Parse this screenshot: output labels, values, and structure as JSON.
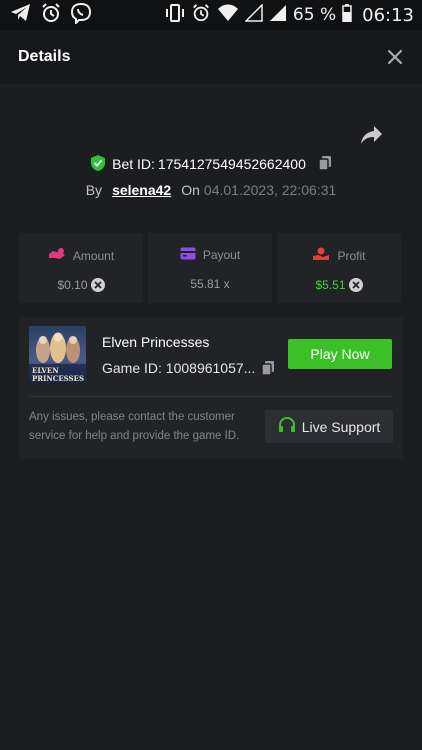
{
  "statusbar": {
    "battery": "65 %",
    "time": "06:13"
  },
  "header": {
    "title": "Details"
  },
  "bet": {
    "id_label": "Bet ID:",
    "id_value": "1754127549452662400",
    "by_label": "By",
    "username": "selena42",
    "on_label": "On",
    "date": "04.01.2023, 22:06:31"
  },
  "stats": {
    "amount": {
      "label": "Amount",
      "value": "$0.10"
    },
    "payout": {
      "label": "Payout",
      "value": "55.81 x"
    },
    "profit": {
      "label": "Profit",
      "value": "$5.51"
    }
  },
  "game": {
    "name": "Elven Princesses",
    "id_label": "Game ID:",
    "id_value": "1008961057...",
    "thumb_line1": "ELVEN",
    "thumb_line2": "PRINCESSES",
    "play_label": "Play Now",
    "issue_text": "Any issues, please contact the customer service for help and provide the game ID.",
    "support_label": "Live Support"
  },
  "colors": {
    "accent_green": "#3bc127",
    "profit_green": "#3fd43c",
    "shield_green": "#2fc235",
    "amount_icon": "#e0377f",
    "payout_icon": "#8a4fe6",
    "profit_icon": "#e04040"
  },
  "icons": [
    "telegram-icon",
    "alarm-icon",
    "viber-icon",
    "vibrate-icon",
    "wifi-icon",
    "signal-icon",
    "battery-icon",
    "close-icon",
    "share-icon",
    "shield-check-icon",
    "copy-icon",
    "amount-icon",
    "payout-icon",
    "profit-icon",
    "headset-icon"
  ]
}
